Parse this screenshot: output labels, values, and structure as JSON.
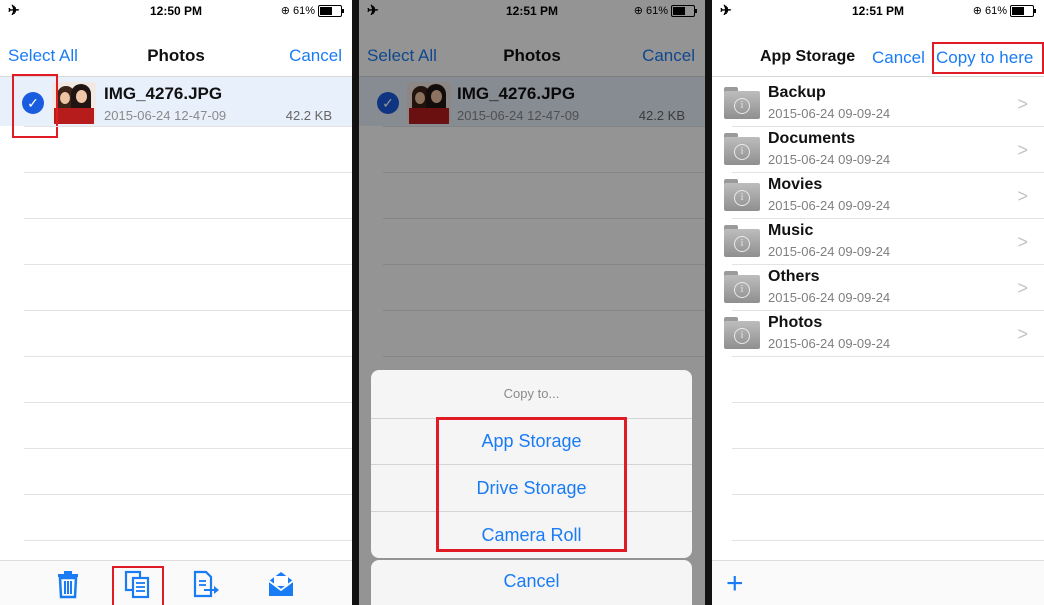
{
  "panel1": {
    "status": {
      "time": "12:50 PM",
      "battery": "61%"
    },
    "nav": {
      "left": "Select All",
      "title": "Photos",
      "right": "Cancel"
    },
    "file": {
      "name": "IMG_4276.JPG",
      "date": "2015-06-24 12-47-09",
      "size": "42.2 KB"
    },
    "toolbar": [
      "trash-icon",
      "copy-icon",
      "move-icon",
      "mail-icon"
    ]
  },
  "panel2": {
    "status": {
      "time": "12:51 PM",
      "battery": "61%"
    },
    "nav": {
      "left": "Select All",
      "title": "Photos",
      "right": "Cancel"
    },
    "file": {
      "name": "IMG_4276.JPG",
      "date": "2015-06-24 12-47-09",
      "size": "42.2 KB"
    },
    "sheet": {
      "title": "Copy to...",
      "options": [
        "App Storage",
        "Drive Storage",
        "Camera Roll"
      ],
      "cancel": "Cancel"
    }
  },
  "panel3": {
    "status": {
      "time": "12:51 PM",
      "battery": "61%"
    },
    "nav": {
      "title": "App Storage",
      "cancel": "Cancel",
      "copy": "Copy to here"
    },
    "folders": [
      {
        "name": "Backup",
        "date": "2015-06-24 09-09-24"
      },
      {
        "name": "Documents",
        "date": "2015-06-24 09-09-24"
      },
      {
        "name": "Movies",
        "date": "2015-06-24 09-09-24"
      },
      {
        "name": "Music",
        "date": "2015-06-24 09-09-24"
      },
      {
        "name": "Others",
        "date": "2015-06-24 09-09-24"
      },
      {
        "name": "Photos",
        "date": "2015-06-24 09-09-24"
      }
    ],
    "add": "+"
  },
  "colors": {
    "accent": "#1a7cf5",
    "highlight": "#e01b24",
    "selected_row": "#e8f0fb"
  }
}
